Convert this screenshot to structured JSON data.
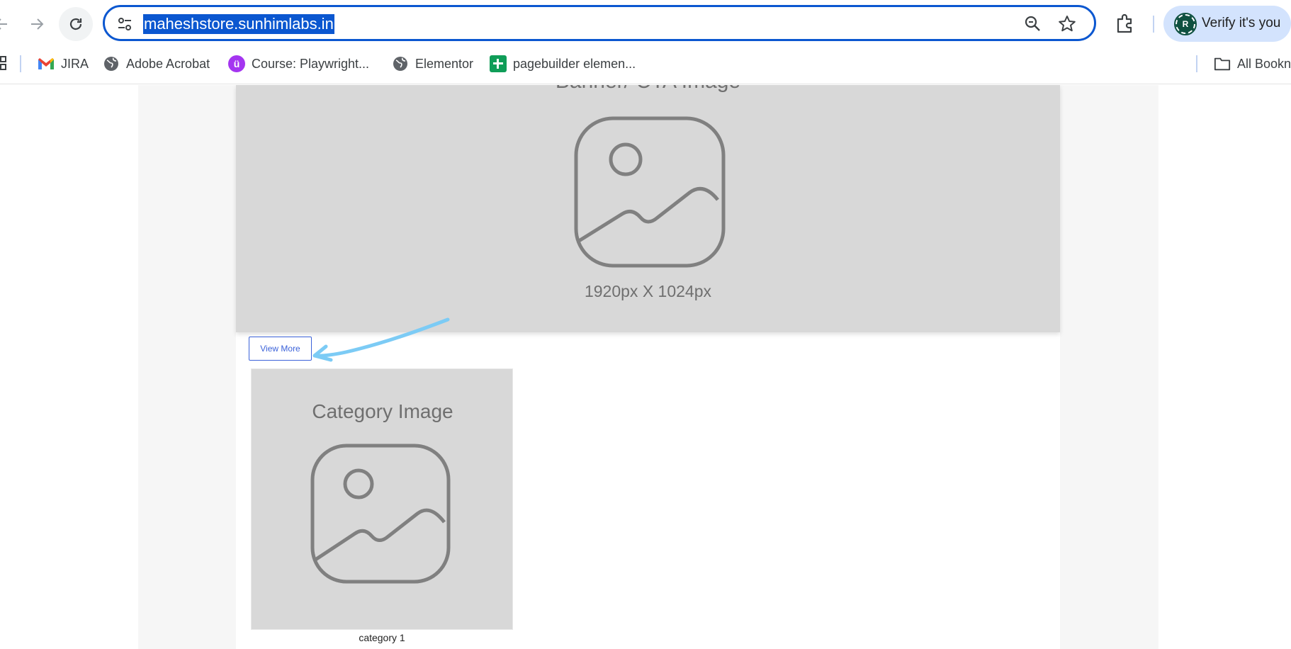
{
  "browser": {
    "url": "maheshstore.sunhimlabs.in",
    "profile_chip_label": "Verify it's you",
    "profile_initial": "R",
    "icons": [
      "back-icon",
      "forward-icon",
      "reload-icon",
      "site-settings-icon",
      "zoom-icon",
      "bookmark-star-icon",
      "extensions-icon"
    ]
  },
  "bookmarks": {
    "items": [
      {
        "label": "JIRA",
        "icon": "gmail-icon"
      },
      {
        "label": "Adobe Acrobat",
        "icon": "globe-icon"
      },
      {
        "label": "Course: Playwright...",
        "icon": "udemy-icon"
      },
      {
        "label": "Elementor",
        "icon": "globe-icon"
      },
      {
        "label": "pagebuilder elemen...",
        "icon": "sheets-icon"
      }
    ],
    "all_bookmarks_label": "All Bookn"
  },
  "page": {
    "banner": {
      "title": "Banner/ CTA Image",
      "size_label": "1920px X 1024px"
    },
    "view_more_label": "View More",
    "category": {
      "image_label": "Category Image",
      "caption": "category 1"
    }
  },
  "colors": {
    "omnibox_border": "#0b57d0",
    "placeholder_bg": "#d8d8d8",
    "button_blue": "#3b62d9",
    "arrow": "#7ccbf5"
  }
}
